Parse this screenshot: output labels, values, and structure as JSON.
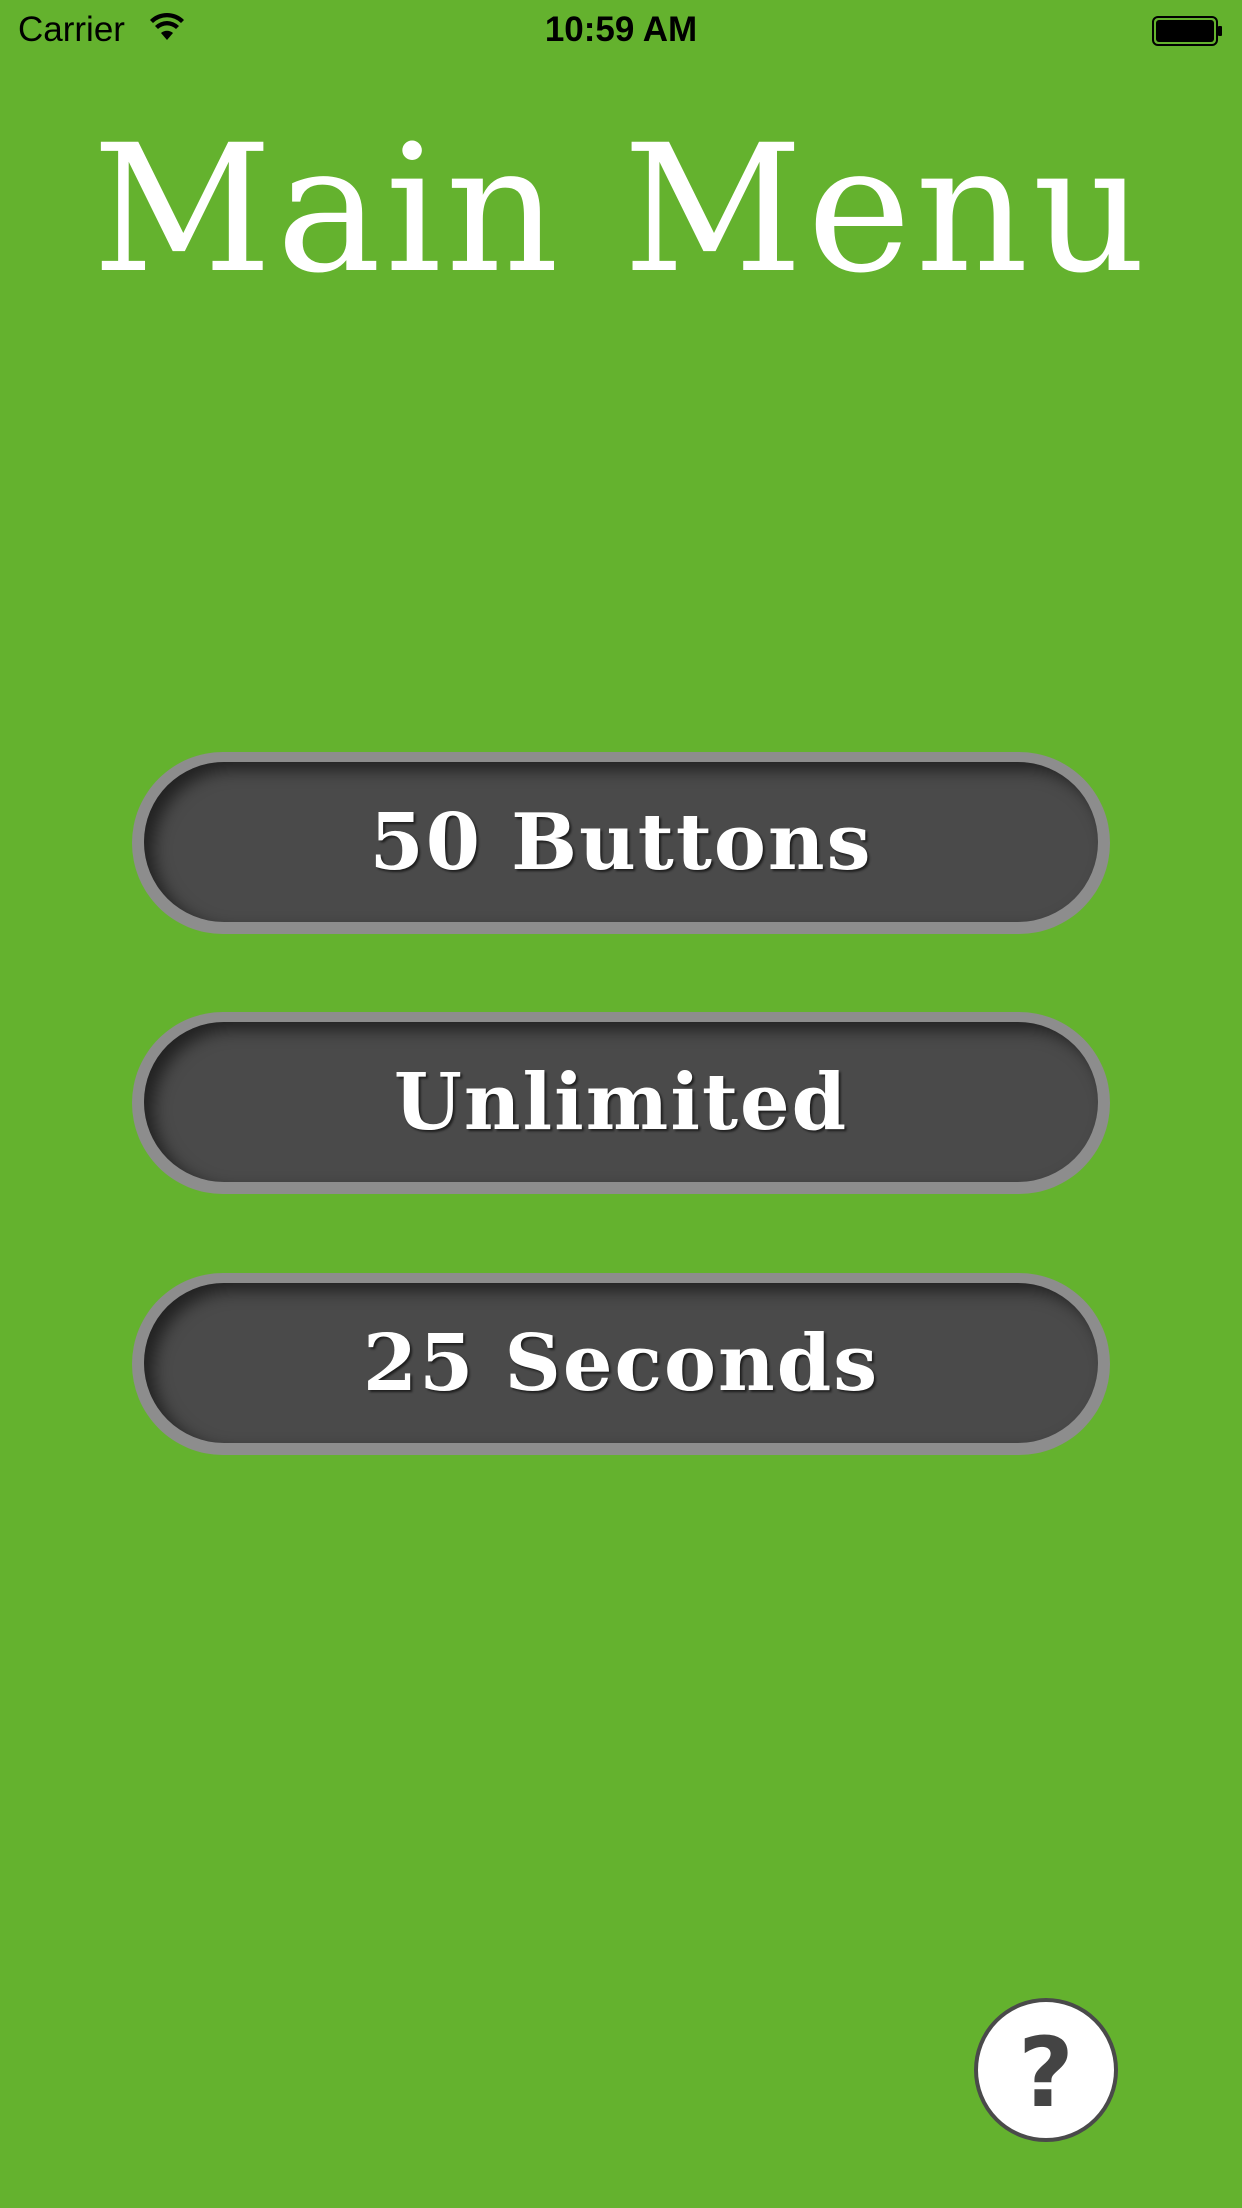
{
  "status_bar": {
    "carrier": "Carrier",
    "time": "10:59 AM",
    "wifi_icon": "wifi-icon",
    "battery_icon": "battery-icon"
  },
  "title": "Main Menu",
  "menu": {
    "buttons": [
      {
        "label": "50 Buttons"
      },
      {
        "label": "Unlimited"
      },
      {
        "label": "25 Seconds"
      }
    ]
  },
  "help": {
    "label": "?",
    "icon": "help-icon"
  },
  "colors": {
    "background": "#64b22e",
    "button_fill": "#4a4a4a",
    "button_border": "#8d8d8d",
    "text": "#ffffff"
  }
}
